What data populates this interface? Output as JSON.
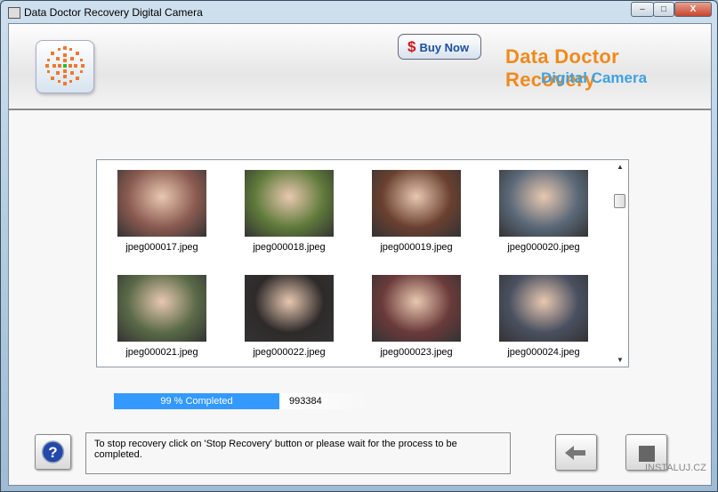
{
  "window": {
    "title": "Data Doctor Recovery Digital Camera",
    "minimize": "–",
    "maximize": "□",
    "close": "X"
  },
  "header": {
    "buy_now": "Buy Now",
    "buy_icon": "$",
    "brand_line1": "Data Doctor Recovery",
    "brand_line2": "Digital Camera"
  },
  "thumbnails": [
    {
      "label": "jpeg000017.jpeg",
      "color": "#8a5a50"
    },
    {
      "label": "jpeg000018.jpeg",
      "color": "#5f7a3a"
    },
    {
      "label": "jpeg000019.jpeg",
      "color": "#6a4030"
    },
    {
      "label": "jpeg000020.jpeg",
      "color": "#5a6878"
    },
    {
      "label": "jpeg000021.jpeg",
      "color": "#5a6a48"
    },
    {
      "label": "jpeg000022.jpeg",
      "color": "#2e2a2a"
    },
    {
      "label": "jpeg000023.jpeg",
      "color": "#6a3a3a"
    },
    {
      "label": "jpeg000024.jpeg",
      "color": "#4a5060"
    }
  ],
  "progress": {
    "label": "99 % Completed",
    "percent": 99,
    "count": "993384"
  },
  "message": "To stop recovery click on 'Stop Recovery' button or please wait for the process to be completed.",
  "watermark": "INSTALUJ.CZ"
}
